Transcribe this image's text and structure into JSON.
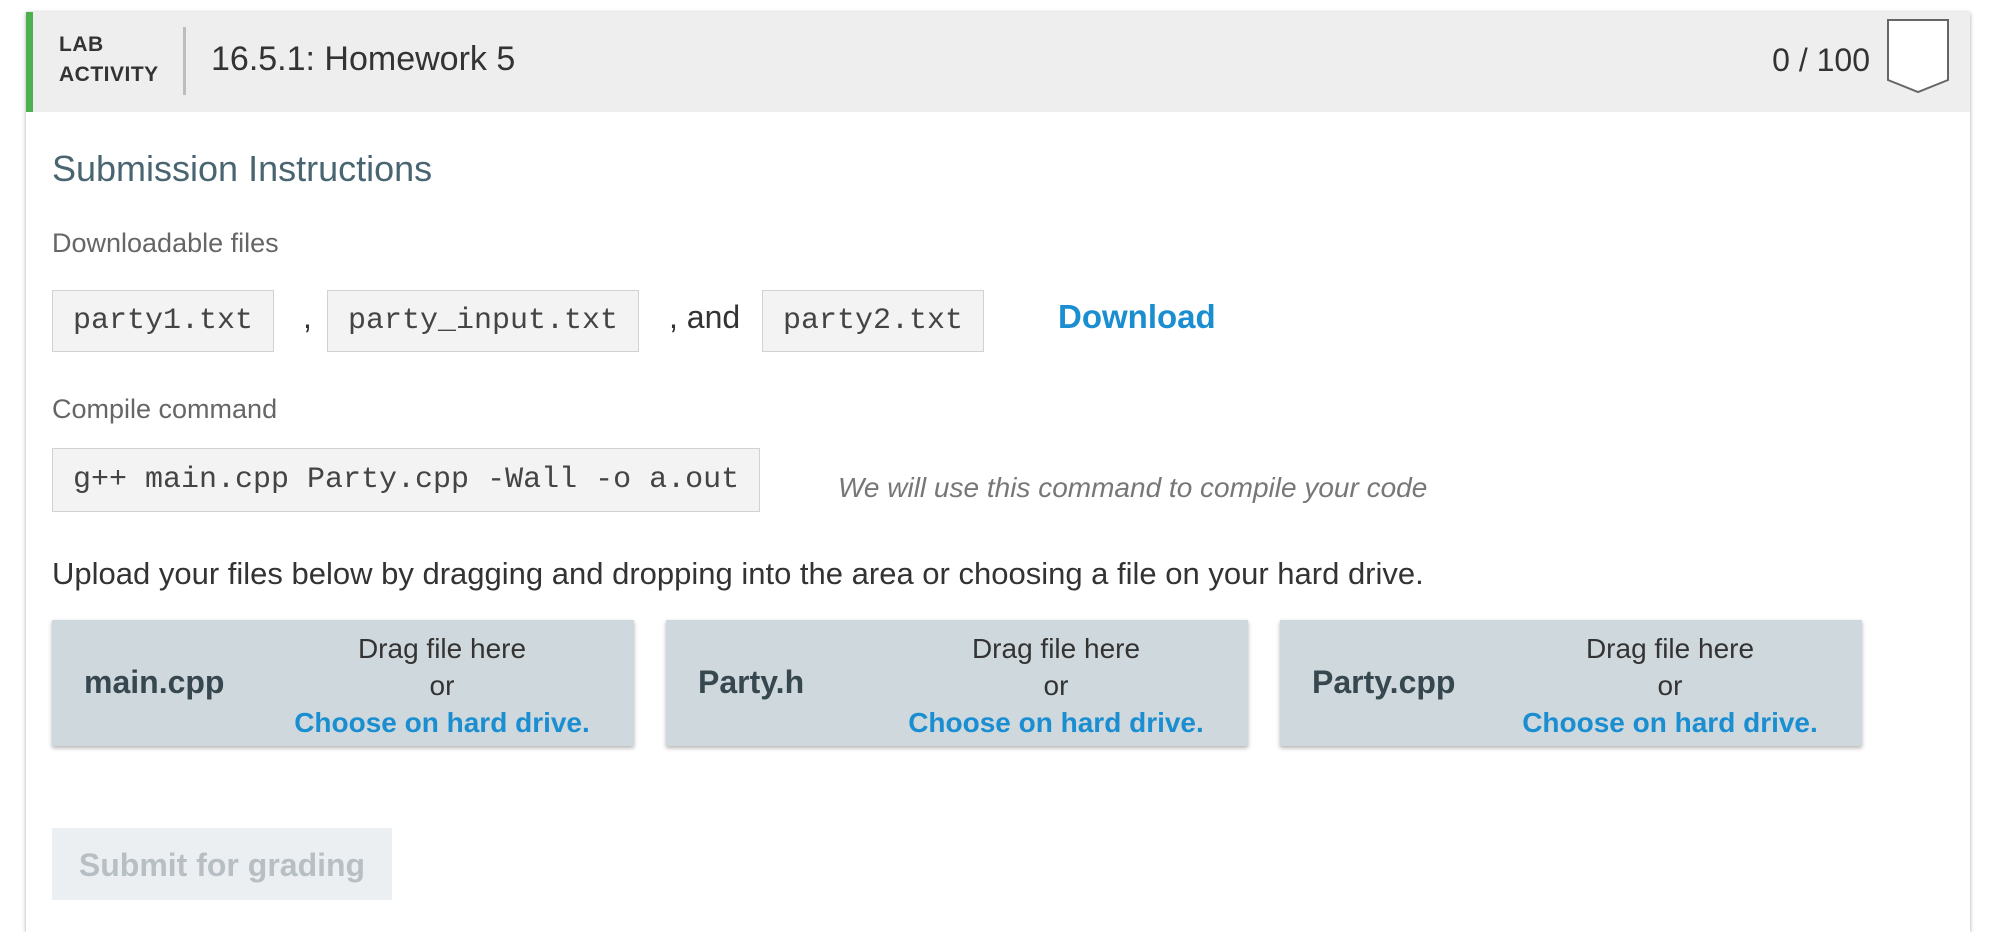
{
  "header": {
    "label_line1": "LAB",
    "label_line2": "ACTIVITY",
    "title": "16.5.1: Homework 5",
    "score": "0 / 100",
    "accent_color": "#4caf50"
  },
  "section_title": "Submission Instructions",
  "downloadable": {
    "label": "Downloadable files",
    "files": [
      "party1.txt",
      "party_input.txt",
      "party2.txt"
    ],
    "sep_comma": ",",
    "sep_and": ", and",
    "download_label": "Download",
    "link_color": "#1a8ed0"
  },
  "compile": {
    "label": "Compile command",
    "command": "g++ main.cpp Party.cpp -Wall -o a.out",
    "note": "We will use this command to compile your code"
  },
  "upload": {
    "instructions": "Upload your files below by dragging and dropping into the area or choosing a file on your hard drive.",
    "zones": [
      {
        "file": "main.cpp",
        "drag": "Drag file here",
        "or": "or",
        "choose": "Choose on hard drive."
      },
      {
        "file": "Party.h",
        "drag": "Drag file here",
        "or": "or",
        "choose": "Choose on hard drive."
      },
      {
        "file": "Party.cpp",
        "drag": "Drag file here",
        "or": "or",
        "choose": "Choose on hard drive."
      }
    ]
  },
  "submit_label": "Submit for grading"
}
